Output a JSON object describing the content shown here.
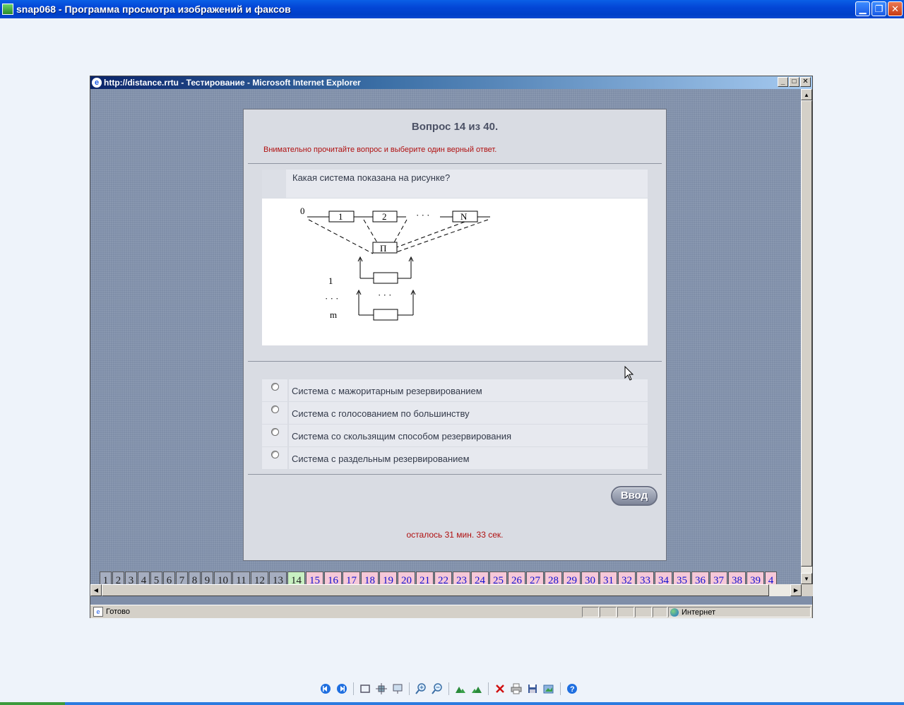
{
  "viewer": {
    "title": "snap068 - Программа просмотра изображений и факсов",
    "toolbar_icons": [
      "prev-image-icon",
      "next-image-icon",
      "best-fit-icon",
      "actual-size-icon",
      "slideshow-icon",
      "zoom-in-icon",
      "zoom-out-icon",
      "rotate-clockwise-icon",
      "rotate-counterclockwise-icon",
      "delete-icon",
      "print-icon",
      "save-icon",
      "edit-icon",
      "help-icon"
    ]
  },
  "browser": {
    "title": "http://distance.rrtu - Тестирование - Microsoft Internet Explorer",
    "status_text": "Готово",
    "zone_text": "Интернет"
  },
  "test": {
    "question_title": "Вопрос 14 из 40.",
    "hint": "Внимательно прочитайте вопрос и выберите один верный ответ.",
    "question_text": "Какая система показана на рисунке?",
    "figure_labels": {
      "zero": "0",
      "box1": "1",
      "box2": "2",
      "dots_top": "· · ·",
      "boxN": "N",
      "switch": "П",
      "reserve1": "1",
      "dots_left": "· · ·",
      "reserve_m": "m",
      "dots_mid": "· · ·"
    },
    "answers": [
      "Система с мажоритарным резервированием",
      "Система с голосованием по большинству",
      "Система со скользящим способом резервирования",
      "Система с раздельным резервированием"
    ],
    "submit_label": "Ввод",
    "timer": "осталось 31 мин. 33 сек."
  },
  "navigator": {
    "cells": [
      {
        "label": "1",
        "state": "done"
      },
      {
        "label": "2",
        "state": "done"
      },
      {
        "label": "3",
        "state": "done"
      },
      {
        "label": "4",
        "state": "done"
      },
      {
        "label": "5",
        "state": "done"
      },
      {
        "label": "6",
        "state": "done"
      },
      {
        "label": "7",
        "state": "done"
      },
      {
        "label": "8",
        "state": "done"
      },
      {
        "label": "9",
        "state": "done"
      },
      {
        "label": "10",
        "state": "done"
      },
      {
        "label": "11",
        "state": "done"
      },
      {
        "label": "12",
        "state": "done"
      },
      {
        "label": "13",
        "state": "done"
      },
      {
        "label": "14",
        "state": "current"
      },
      {
        "label": "15",
        "state": "todo"
      },
      {
        "label": "16",
        "state": "todo"
      },
      {
        "label": "17",
        "state": "todo"
      },
      {
        "label": "18",
        "state": "todo"
      },
      {
        "label": "19",
        "state": "todo"
      },
      {
        "label": "20",
        "state": "todo"
      },
      {
        "label": "21",
        "state": "todo"
      },
      {
        "label": "22",
        "state": "todo"
      },
      {
        "label": "23",
        "state": "todo"
      },
      {
        "label": "24",
        "state": "todo"
      },
      {
        "label": "25",
        "state": "todo"
      },
      {
        "label": "26",
        "state": "todo"
      },
      {
        "label": "27",
        "state": "todo"
      },
      {
        "label": "28",
        "state": "todo"
      },
      {
        "label": "29",
        "state": "todo"
      },
      {
        "label": "30",
        "state": "todo"
      },
      {
        "label": "31",
        "state": "todo"
      },
      {
        "label": "32",
        "state": "todo"
      },
      {
        "label": "33",
        "state": "todo"
      },
      {
        "label": "34",
        "state": "todo"
      },
      {
        "label": "35",
        "state": "todo"
      },
      {
        "label": "36",
        "state": "todo"
      },
      {
        "label": "37",
        "state": "todo"
      },
      {
        "label": "38",
        "state": "todo"
      },
      {
        "label": "39",
        "state": "todo"
      },
      {
        "label": "4",
        "state": "todo"
      }
    ]
  },
  "colors": {
    "hint_red": "#b01010",
    "done_cell": "#a6aec0",
    "current_cell": "#c8f0c2",
    "todo_cell": "#f6c8d8"
  }
}
